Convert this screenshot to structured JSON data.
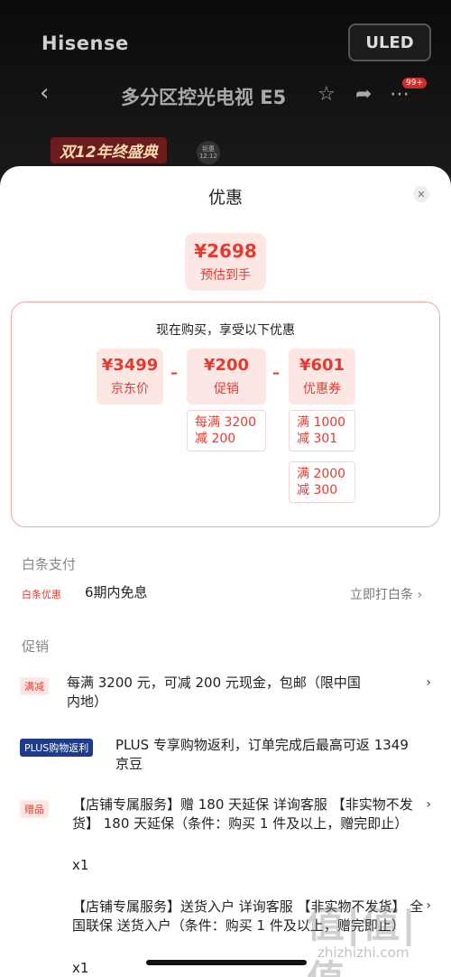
{
  "background": {
    "brand": "Hisense",
    "uled_logo": "ULED",
    "page_title": "多分区控光电视 E5",
    "badge": "99+",
    "banner": "双12年终盛典",
    "banner_date": "钜惠 12.12"
  },
  "sheet": {
    "title": "优惠",
    "final_price": {
      "amount": "¥2698",
      "label": "预估到手"
    },
    "breakdown_heading": "现在购买，享受以下优惠",
    "items": [
      {
        "amount": "¥3499",
        "label": "京东价"
      },
      {
        "amount": "¥200",
        "label": "促销"
      },
      {
        "amount": "¥601",
        "label": "优惠券"
      }
    ],
    "promo_rules": [
      "每满 3200 减 200"
    ],
    "coupon_rules": [
      "满 1000 减 301",
      "满 2000 减 300"
    ],
    "operator": "–"
  },
  "baitiao": {
    "section": "白条支付",
    "tag": "白条优惠",
    "text": "6期内免息",
    "link": "立即打白条 ›"
  },
  "promotions": {
    "section": "促销",
    "rows": [
      {
        "tag": "满减",
        "text": "每满 3200 元，可减 200 元现金，包邮（限中国内地）"
      },
      {
        "tag": "PLUS购物返利",
        "text": "PLUS 专享购物返利，订单完成后最高可返 1349 京豆"
      },
      {
        "tag": "赠品",
        "text": "【店铺专属服务】赠 180 天延保 详询客服 【非实物不发货】 180 天延保（条件：购买 1 件及以上，赠完即止）",
        "qty": "x1"
      },
      {
        "text": "【店铺专属服务】送货入户 详询客服 【非实物不发货】 全国联保 送货入户（条件：购买 1 件及以上，赠完即止）",
        "qty": "x1"
      }
    ]
  },
  "watermark": {
    "main": "值|值|值",
    "sub": "zhizhizhi.com"
  },
  "icons": {
    "back": "chevron-left-icon",
    "star": "star-icon",
    "share": "share-icon",
    "more": "more-icon",
    "close": "close-icon",
    "chevron": "chevron-right-icon"
  }
}
